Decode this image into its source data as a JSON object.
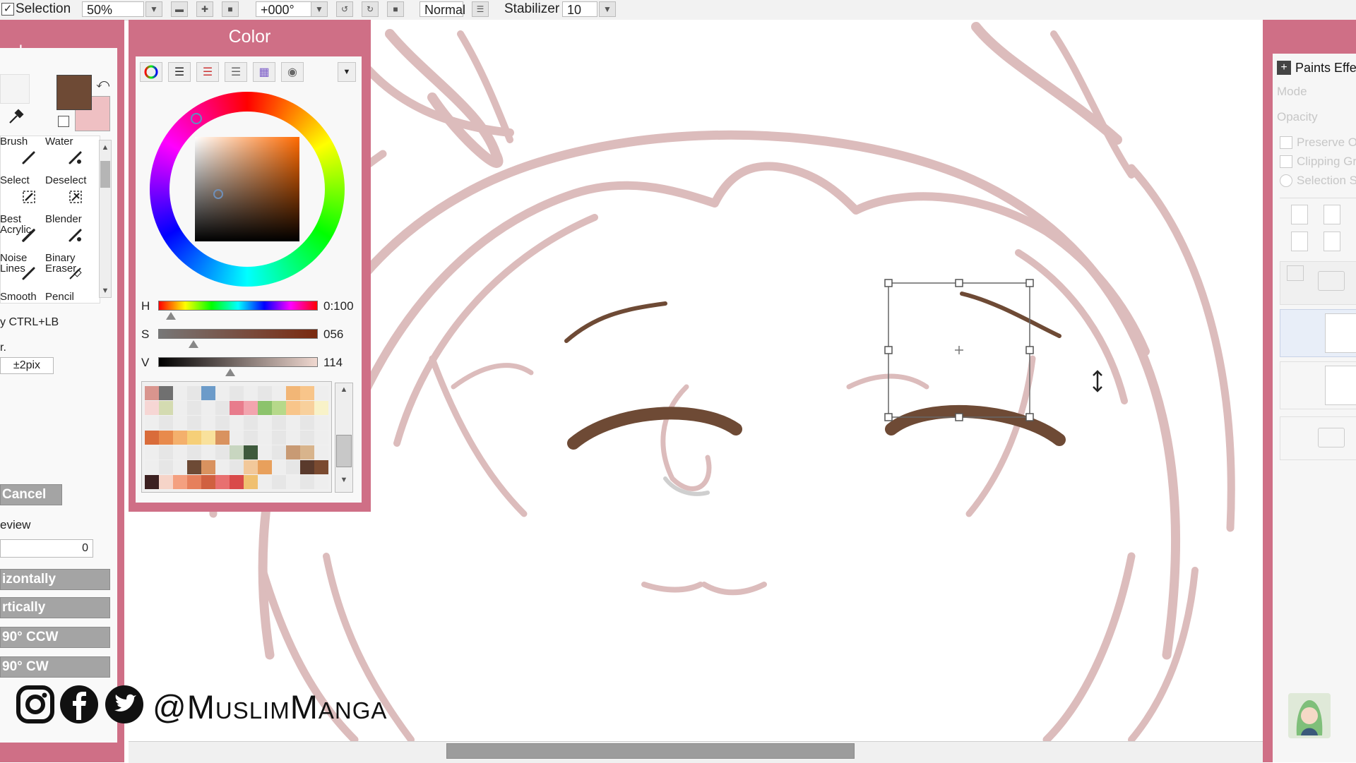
{
  "toolbar": {
    "selection_label": "Selection",
    "zoom_value": "50%",
    "rotation_value": "+000°",
    "blend_mode": "Normal",
    "stabilizer_label": "Stabilizer",
    "stabilizer_value": "10"
  },
  "tool_panel": {
    "title": "ool",
    "primary_color": "#6e4a35",
    "secondary_color": "#efc0c3",
    "tools": [
      {
        "label": "Brush",
        "icon": "brush-icon"
      },
      {
        "label": "Water",
        "icon": "water-brush-icon"
      },
      {
        "label": "Select",
        "icon": "select-icon"
      },
      {
        "label": "Deselect",
        "icon": "deselect-icon"
      },
      {
        "label": "Best\nAcrylic",
        "icon": "acrylic-icon"
      },
      {
        "label": "Blender",
        "icon": "blender-icon"
      },
      {
        "label": "Noise\nLines",
        "icon": "noise-lines-icon"
      },
      {
        "label": "Binary\nEraser",
        "icon": "binary-eraser-icon"
      },
      {
        "label": "Smooth",
        "icon": "smooth-icon"
      },
      {
        "label": "Pencil",
        "icon": "pencil-icon"
      }
    ],
    "hint_text": "y CTRL+LB",
    "hint_text2": "r.",
    "pixel_value": "±2pix",
    "cancel_label": "Cancel",
    "preview_label": "eview",
    "preview_value": "0",
    "flip_horizontal_label": "izontally",
    "flip_vertical_label": "rtically",
    "rotate_ccw_label": "90° CCW",
    "rotate_cw_label": "90° CW"
  },
  "color_panel": {
    "title": "Color",
    "h_label": "H",
    "h_value": "0:100",
    "s_label": "S",
    "s_value": "056",
    "v_label": "V",
    "v_value": "114",
    "h_fraction": 0.08,
    "s_fraction": 0.22,
    "v_fraction": 0.45,
    "swatch_rows": [
      [
        "#d9958e",
        "#707070",
        "#eeeeee",
        "#e6e6e6",
        "#6c9bc9",
        "#eeeeee",
        "#e6e6e6",
        "#eeeeee",
        "#e6e6e6",
        "#eeeeee",
        "#f2b676",
        "#f8c58a",
        "#eeeeee"
      ],
      [
        "#f6d6d4",
        "#d4dbb1",
        "#eeeeee",
        "#e6e6e6",
        "#eeeeee",
        "#e6e6e6",
        "#e87c8c",
        "#f2a4ae",
        "#8cc36c",
        "#b6d98a",
        "#f8c58a",
        "#f8d09c",
        "#f8f2c8"
      ],
      [
        "#eeeeee",
        "#e6e6e6",
        "#eeeeee",
        "#e6e6e6",
        "#eeeeee",
        "#e6e6e6",
        "#eeeeee",
        "#e6e6e6",
        "#eeeeee",
        "#e6e6e6",
        "#eeeeee",
        "#e6e6e6",
        "#eeeeee"
      ],
      [
        "#d96c3a",
        "#e88a4c",
        "#f4b06c",
        "#f6cf78",
        "#f9e19c",
        "#d9925f",
        "#eeeeee",
        "#e6e6e6",
        "#eeeeee",
        "#e6e6e6",
        "#eeeeee",
        "#e6e6e6",
        "#eeeeee"
      ],
      [
        "#eeeeee",
        "#e6e6e6",
        "#eeeeee",
        "#e6e6e6",
        "#eeeeee",
        "#e6e6e6",
        "#c8d6c0",
        "#3e5a3c",
        "#eeeeee",
        "#e6e6e6",
        "#c89a74",
        "#d8b48c",
        "#eeeeee"
      ],
      [
        "#eeeeee",
        "#e6e6e6",
        "#eeeeee",
        "#6d4a35",
        "#d9925f",
        "#eeeeee",
        "#e6e6e6",
        "#f2c89a",
        "#e8a05c",
        "#eeeeee",
        "#e6e6e6",
        "#5a3a2c",
        "#7a4a30"
      ],
      [
        "#3c2020",
        "#f6d4c8",
        "#f4a080",
        "#e6805c",
        "#d06040",
        "#e87070",
        "#d94a4a",
        "#f0c070",
        "#eeeeee",
        "#e6e6e6",
        "#eeeeee",
        "#e6e6e6",
        "#eeeeee"
      ]
    ]
  },
  "layer_panel": {
    "title": "Paints Effe",
    "mode_label": "Mode",
    "opacity_label": "Opacity",
    "preserve_label": "Preserve O",
    "clipping_label": "Clipping Gr",
    "selection_label": "Selection S"
  },
  "social": {
    "handle": "@MuslimManga",
    "icons": [
      "instagram-icon",
      "facebook-icon",
      "twitter-icon"
    ]
  },
  "colors": {
    "accent": "#cf6f86",
    "sketch": "#dcbcbc",
    "brow": "#6e4a35"
  }
}
